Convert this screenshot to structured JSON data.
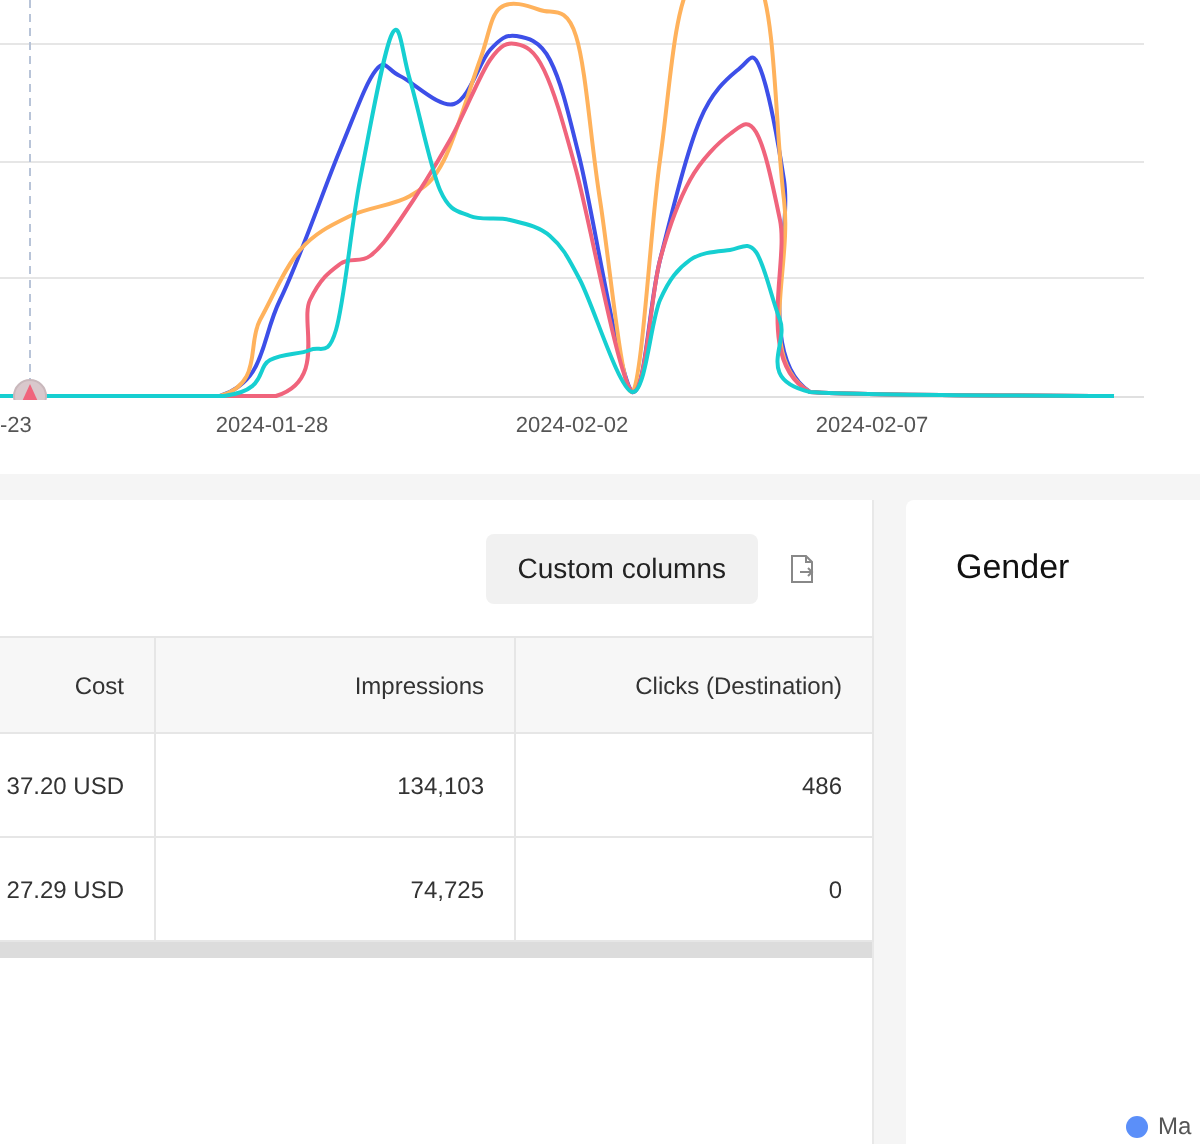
{
  "chart": {
    "x_labels": [
      "-23",
      "2024-01-28",
      "2024-02-02",
      "2024-02-07"
    ],
    "lines": [
      {
        "color": "#3d4fe8"
      },
      {
        "color": "#ffb25c"
      },
      {
        "color": "#f0647c"
      },
      {
        "color": "#16cfd1"
      }
    ]
  },
  "table_toolbar": {
    "custom_columns_button": "Custom columns"
  },
  "table": {
    "columns": [
      "Cost",
      "Impressions",
      "Clicks (Destination)"
    ],
    "rows": [
      [
        "37.20 USD",
        "134,103",
        "486"
      ],
      [
        "27.29 USD",
        "74,725",
        "0"
      ]
    ]
  },
  "gender_card": {
    "title": "Gender",
    "legend": [
      {
        "label": "Ma",
        "color": "#5b8ff9"
      }
    ]
  }
}
